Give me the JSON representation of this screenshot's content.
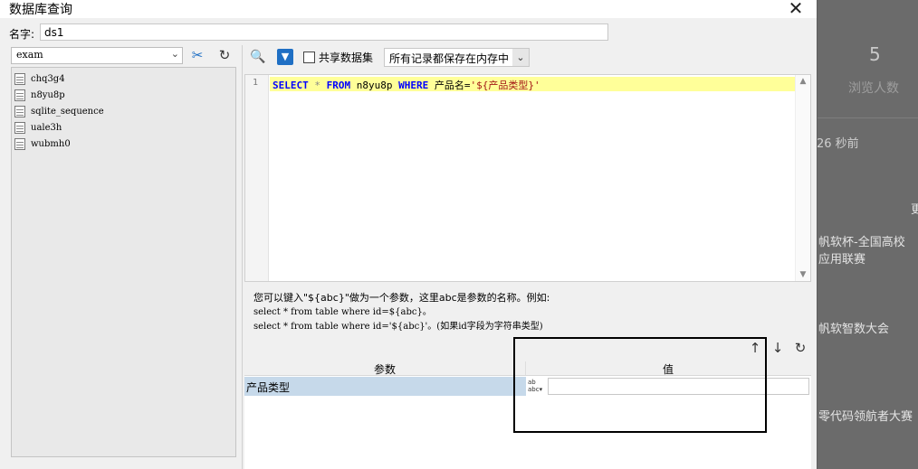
{
  "background": {
    "count": "5",
    "count_label": "浏览人数",
    "time": "26 秒前",
    "news": [
      "帆软杯-全国高校",
      "应用联赛",
      "帆软智数大会",
      "零代码领航者大赛"
    ],
    "edge_char": "更"
  },
  "dialog": {
    "title": "数据库查询",
    "close": "✕",
    "name_label": "名字:",
    "name_value": "ds1"
  },
  "left": {
    "database": "exam",
    "tables": [
      "chq3g4",
      "n8yu8p",
      "sqlite_sequence",
      "uale3h",
      "wubmh0"
    ]
  },
  "toolbar": {
    "share_label": "共享数据集",
    "memory_option": "所有记录都保存在内存中"
  },
  "editor": {
    "line_number": "1",
    "sql": {
      "kw1": "SELECT",
      "star": "*",
      "kw2": "FROM",
      "table": "n8yu8p",
      "kw3": "WHERE",
      "cond": "产品名=",
      "param": "'${产品类型}'"
    }
  },
  "help": {
    "line1": "您可以键入\"${abc}\"做为一个参数，这里abc是参数的名称。例如:",
    "line2": "select * from table where id=${abc}。",
    "line3": "select * from table where id='${abc}'。(如果id字段为字符串类型)"
  },
  "params": {
    "header_param": "参数",
    "header_value": "值",
    "rows": [
      {
        "name": "产品类型",
        "type_icon": "abc",
        "value": ""
      }
    ]
  }
}
